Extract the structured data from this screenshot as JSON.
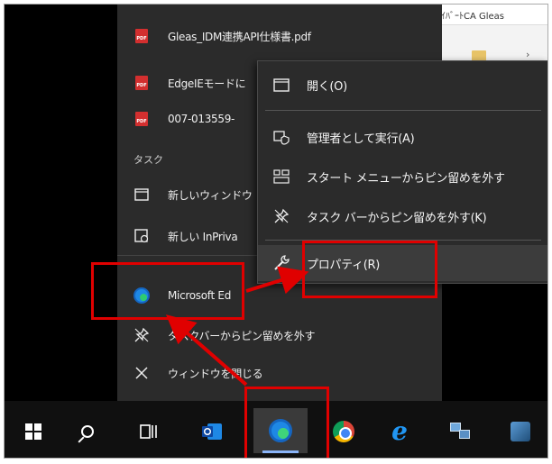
{
  "background_window": {
    "title": "ｲﾊﾞｰﾄCA Gleas"
  },
  "jump_list": {
    "recent": [
      {
        "label": "Gleas_IDM連携API仕様書.pdf",
        "icon": "pdf-icon"
      },
      {
        "label": "EdgeIEモードに",
        "icon": "pdf-icon"
      },
      {
        "label": "007-013559-",
        "icon": "pdf-icon"
      }
    ],
    "section_label": "タスク",
    "tasks": [
      {
        "label": "新しいウィンドウ",
        "icon": "new-window-icon"
      },
      {
        "label": "新しい InPriva",
        "icon": "inprivate-icon"
      }
    ],
    "app": {
      "label": "Microsoft Ed",
      "icon": "edge-icon"
    },
    "actions": [
      {
        "label": "タスクバーからピン留めを外す",
        "icon": "unpin-icon"
      },
      {
        "label": "ウィンドウを閉じる",
        "icon": "close-icon"
      }
    ]
  },
  "context_menu": {
    "items": [
      {
        "label": "開く(O)",
        "icon": "window-icon"
      },
      {
        "label": "管理者として実行(A)",
        "icon": "shield-icon"
      },
      {
        "label": "スタート メニューからピン留めを外す",
        "icon": "start-menu-icon"
      },
      {
        "label": "タスク バーからピン留めを外す(K)",
        "icon": "unpin-icon"
      },
      {
        "label": "プロパティ(R)",
        "icon": "properties-icon"
      }
    ]
  },
  "taskbar": {
    "icons": [
      "windows-start-icon",
      "search-icon",
      "task-view-icon",
      "outlook-icon",
      "edge-icon",
      "chrome-icon",
      "internet-explorer-icon",
      "network-icon",
      "app-icon"
    ]
  },
  "annotation_color": "#e00000"
}
